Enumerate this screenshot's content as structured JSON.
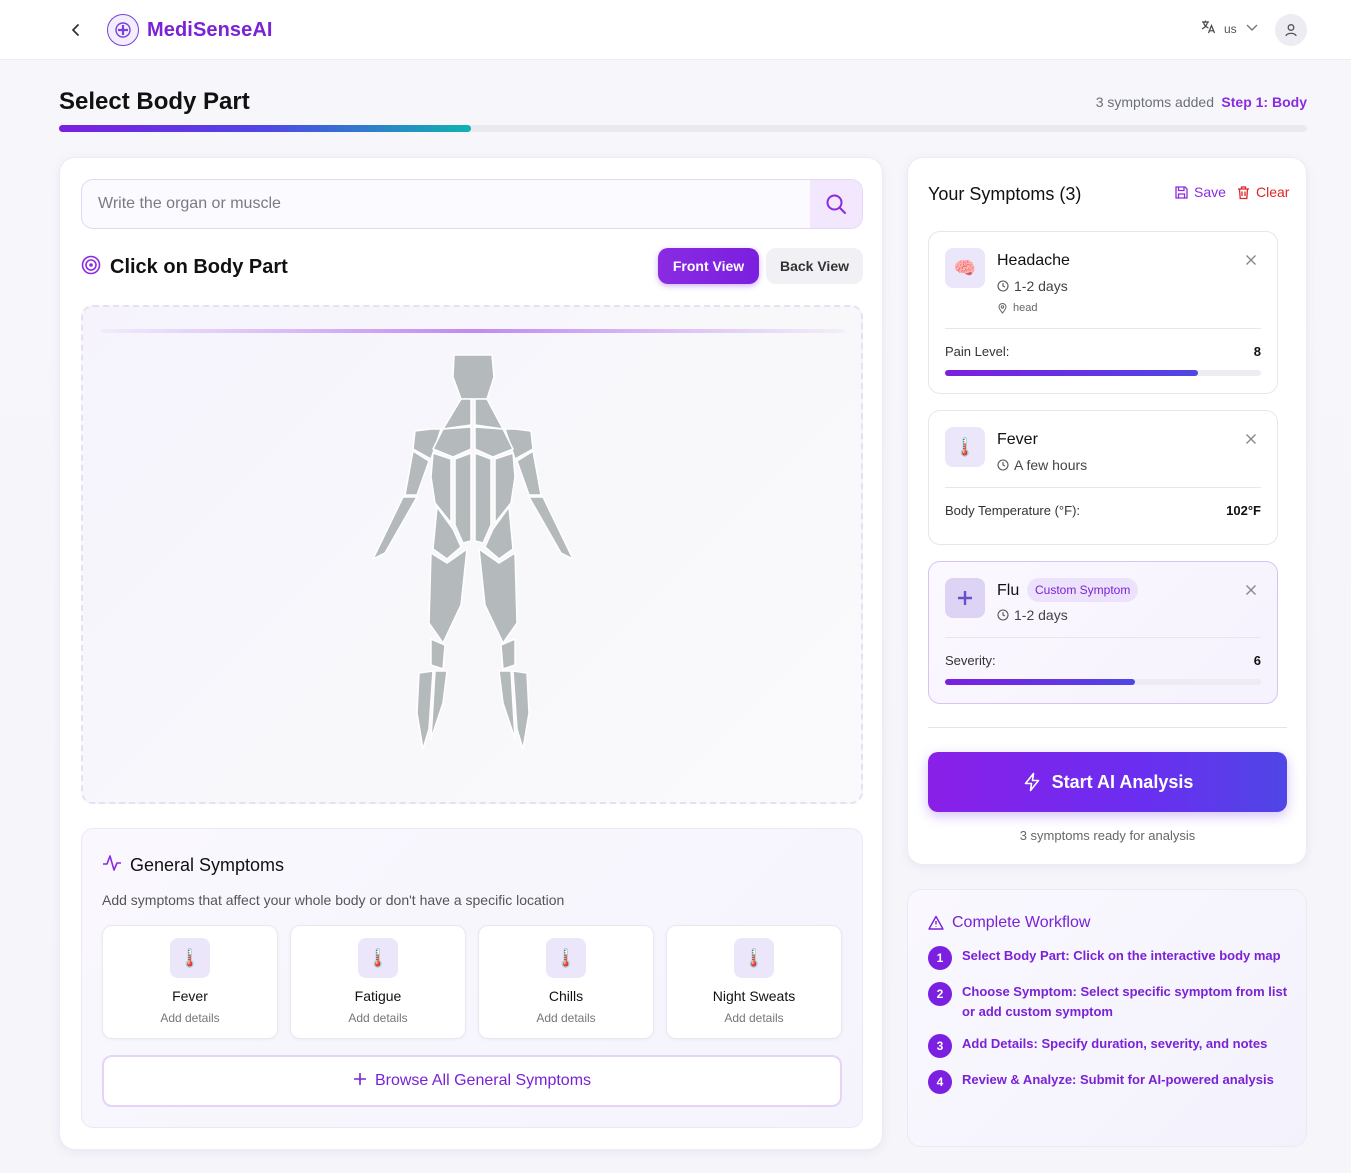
{
  "header": {
    "brand": "MediSenseAI",
    "language": "us"
  },
  "page": {
    "title": "Select Body Part",
    "symptoms_added": "3 symptoms added",
    "step": "Step 1: Body",
    "progress": 0.33
  },
  "search": {
    "placeholder": "Write the organ or muscle"
  },
  "body_map": {
    "title": "Click on Body Part",
    "front_view": "Front View",
    "back_view": "Back View",
    "active_view": "front"
  },
  "general": {
    "title": "General Symptoms",
    "description": "Add symptoms that affect your whole body or don't have a specific location",
    "items": [
      {
        "name": "Fever",
        "sub": "Add details"
      },
      {
        "name": "Fatigue",
        "sub": "Add details"
      },
      {
        "name": "Chills",
        "sub": "Add details"
      },
      {
        "name": "Night Sweats",
        "sub": "Add details"
      }
    ],
    "browse_label": "Browse All General Symptoms"
  },
  "symptoms_panel": {
    "title": "Your Symptoms (3)",
    "save": "Save",
    "clear": "Clear",
    "items": [
      {
        "name": "Headache",
        "duration": "1-2 days",
        "location": "head",
        "metric_label": "Pain Level:",
        "metric_value": "8",
        "level": 0.8,
        "icon": "brain-icon"
      },
      {
        "name": "Fever",
        "duration": "A few hours",
        "metric_label": "Body Temperature (°F):",
        "metric_value": "102°F",
        "icon": "thermometer-icon"
      },
      {
        "name": "Flu",
        "badge": "Custom Symptom",
        "duration": "1-2 days",
        "metric_label": "Severity:",
        "metric_value": "6",
        "level": 0.6,
        "icon": "plus-icon"
      }
    ],
    "analyze_label": "Start AI Analysis",
    "ready_text": "3 symptoms ready for analysis"
  },
  "workflow": {
    "title": "Complete Workflow",
    "steps": [
      {
        "num": "1",
        "text": "Select Body Part: Click on the interactive body map"
      },
      {
        "num": "2",
        "text": "Choose Symptom: Select specific symptom from list or add custom symptom"
      },
      {
        "num": "3",
        "text": "Add Details: Specify duration, severity, and notes"
      },
      {
        "num": "4",
        "text": "Review & Analyze: Submit for AI-powered analysis"
      }
    ]
  },
  "colors": {
    "accent": "#7b1fe0",
    "brand": "#7a22d6",
    "danger": "#dc2626",
    "body_gray": "#b4b9bc"
  }
}
